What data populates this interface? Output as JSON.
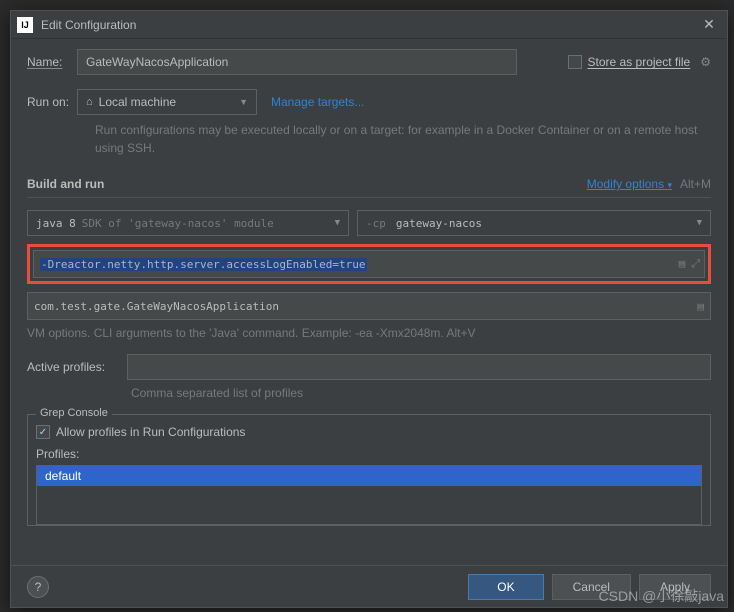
{
  "titlebar": {
    "title": "Edit Configuration"
  },
  "name": {
    "label": "Name:",
    "value": "GateWayNacosApplication"
  },
  "storeProject": {
    "label": "Store as project file"
  },
  "runOn": {
    "label": "Run on:",
    "selected": "Local machine",
    "manage": "Manage targets...",
    "help": "Run configurations may be executed locally or on a target: for example in a Docker Container or on a remote host using SSH."
  },
  "buildAndRun": {
    "title": "Build and run",
    "modify": "Modify options",
    "modifyShortcut": "Alt+M",
    "jdkLabel": "java 8",
    "jdkHint": "SDK of 'gateway-nacos' module",
    "cpPrefix": "-cp",
    "cpValue": "gateway-nacos",
    "vmOptions": "-Dreactor.netty.http.server.accessLogEnabled=true",
    "mainClass": "com.test.gate.GateWayNacosApplication",
    "vmHint": "VM options. CLI arguments to the 'Java' command. Example: -ea -Xmx2048m. Alt+V"
  },
  "activeProfiles": {
    "label": "Active profiles:",
    "value": "",
    "hint": "Comma separated list of profiles"
  },
  "grepConsole": {
    "legend": "Grep Console",
    "allowProfiles": "Allow profiles in Run Configurations",
    "profilesLabel": "Profiles:",
    "profileItems": [
      "default"
    ]
  },
  "buttons": {
    "ok": "OK",
    "cancel": "Cancel",
    "apply": "Apply"
  },
  "watermark": "CSDN @小徐敲java"
}
